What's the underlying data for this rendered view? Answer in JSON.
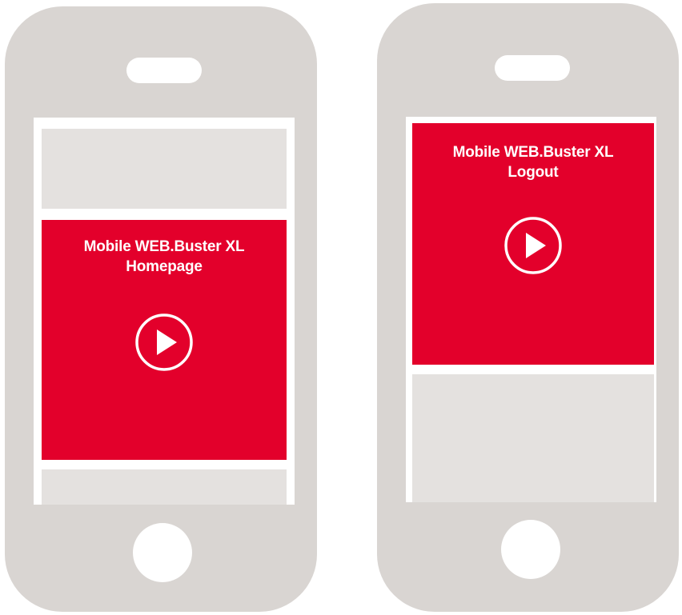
{
  "colors": {
    "phone_body": "#d9d5d2",
    "screen_gap": "#ffffff",
    "placeholder_block": "#e4e1df",
    "video_tile": "#e3002b",
    "tile_text": "#ffffff"
  },
  "phones": [
    {
      "name": "homepage-phone",
      "video": {
        "title_line1": "Mobile WEB.Buster XL",
        "title_line2": "Homepage",
        "icon": "play-icon"
      }
    },
    {
      "name": "logout-phone",
      "video": {
        "title_line1": "Mobile WEB.Buster XL",
        "title_line2": "Logout",
        "icon": "play-icon"
      }
    }
  ]
}
